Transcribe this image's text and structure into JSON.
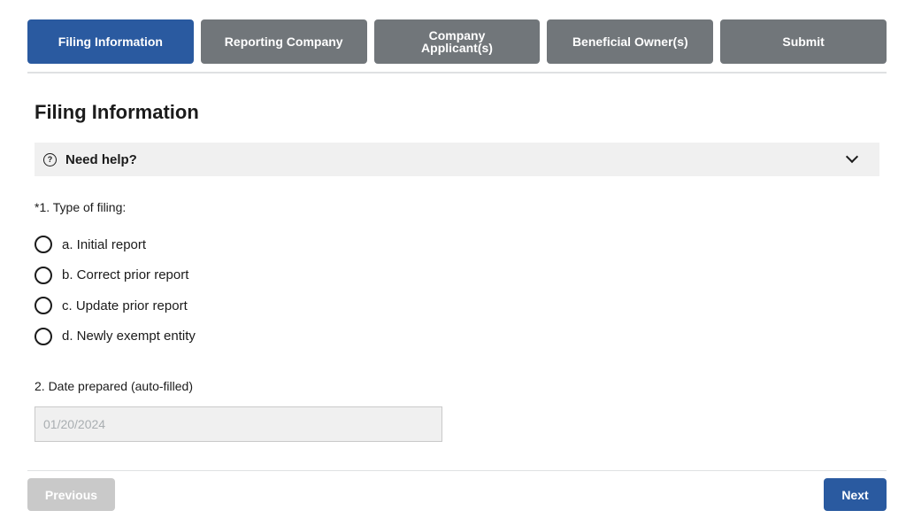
{
  "steps": [
    {
      "label": "Filing Information",
      "active": true
    },
    {
      "label": "Reporting Company",
      "active": false
    },
    {
      "label_line1": "Company",
      "label_line2": "Applicant(s)",
      "active": false
    },
    {
      "label": "Beneficial Owner(s)",
      "active": false
    },
    {
      "label": "Submit",
      "active": false
    }
  ],
  "page_title": "Filing Information",
  "help": {
    "icon": "question-circle-icon",
    "label": "Need help?",
    "expand_icon": "chevron-down-icon"
  },
  "question1": {
    "label": "*1. Type of filing:",
    "options": [
      {
        "label": "a. Initial report",
        "selected": false
      },
      {
        "label": "b. Correct prior report",
        "selected": false
      },
      {
        "label": "c. Update prior report",
        "selected": false
      },
      {
        "label": "d. Newly exempt entity",
        "selected": false
      }
    ]
  },
  "question2": {
    "label": "2. Date prepared (auto-filled)",
    "value": "01/20/2024"
  },
  "nav": {
    "previous_label": "Previous",
    "next_label": "Next"
  },
  "colors": {
    "primary": "#2a5aa0",
    "step_inactive": "#71767a",
    "disabled": "#c9c9c9"
  }
}
